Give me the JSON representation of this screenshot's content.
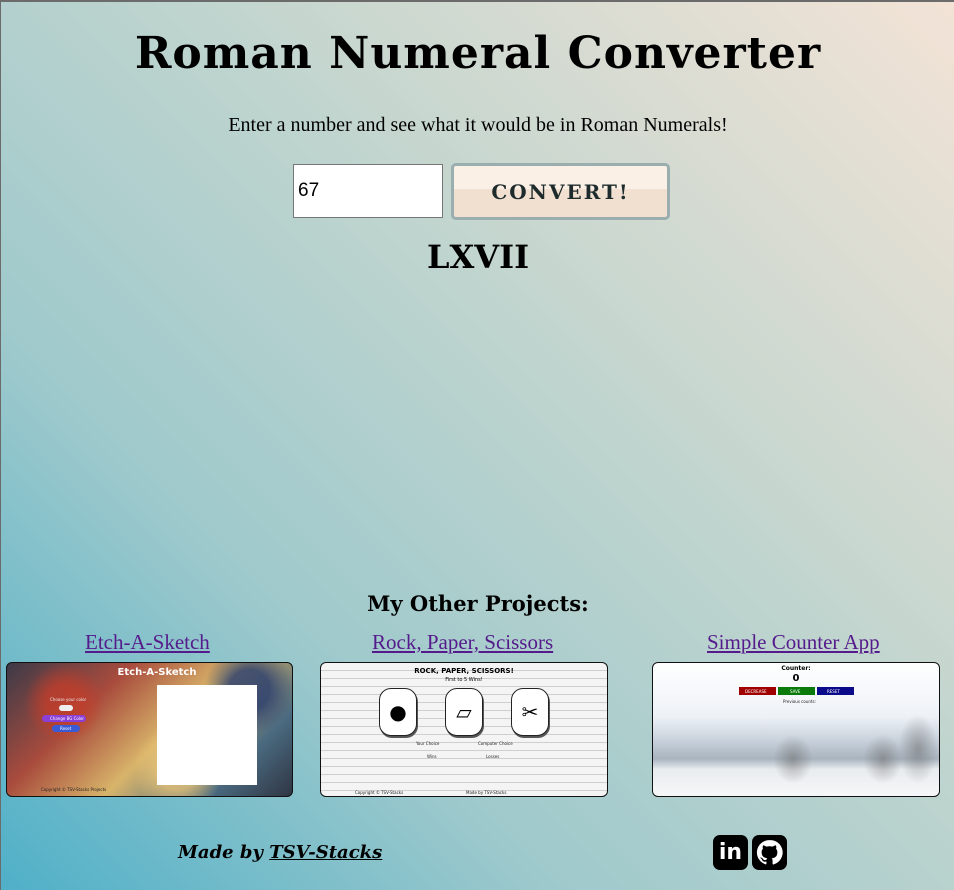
{
  "header": {
    "title": "Roman Numeral Converter",
    "subtitle": "Enter a number and see what it would be in Roman Numerals!"
  },
  "converter": {
    "input_value": "67",
    "button_label": "CONVERT!",
    "result": "LXVII"
  },
  "projects": {
    "heading": "My Other Projects:",
    "items": [
      {
        "label": "Etch-A-Sketch",
        "preview": {
          "title": "Etch-A-Sketch",
          "prompt": "Choose your color",
          "buttons": [
            "Change BG Color",
            "Reset"
          ],
          "footer": "Copyright © TSV-Stacks Projects"
        }
      },
      {
        "label": "Rock, Paper, Scissors",
        "preview": {
          "title": "ROCK, PAPER, SCISSORS!",
          "subtitle": "First to 5 Wins!",
          "your_choice": "Your Choice",
          "computer_choice": "Computer Choice",
          "wins": "Wins",
          "losses": "Losses",
          "footer_left": "Copyright © TSV-Stacks",
          "footer_right": "Made by TSV-Stacks"
        }
      },
      {
        "label": "Simple Counter App",
        "preview": {
          "title": "Counter:",
          "count": "0",
          "buttons": [
            "DECREASE",
            "SAVE",
            "RESET"
          ],
          "note": "Previous counts:"
        }
      }
    ]
  },
  "footer": {
    "made_by_prefix": "Made by ",
    "author": "TSV-Stacks",
    "social": [
      {
        "icon": "linkedin-icon",
        "label": "in"
      },
      {
        "icon": "github-icon"
      }
    ]
  },
  "colors": {
    "link": "#551a8b",
    "decrease": "#a10000",
    "save": "#0a7a0a",
    "reset": "#0a0a8a"
  }
}
